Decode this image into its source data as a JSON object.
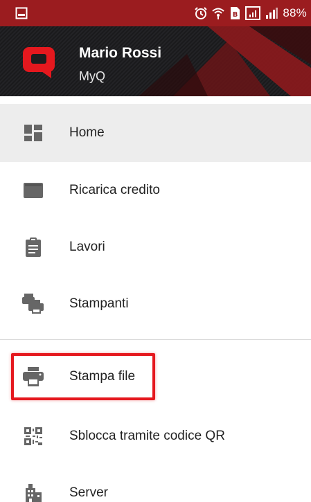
{
  "status_bar": {
    "battery": "88%",
    "background": "#9b1c1f",
    "icons": [
      "image-icon",
      "alarm-icon",
      "wifi-icon",
      "sim-icon",
      "signal-icon",
      "signal-icon"
    ]
  },
  "header": {
    "user_name": "Mario Rossi",
    "subtitle": "MyQ",
    "logo_color": "#e5181e"
  },
  "menu": {
    "items": [
      {
        "label": "Home",
        "icon": "dashboard-icon",
        "selected": true
      },
      {
        "label": "Ricarica credito",
        "icon": "credit-card-icon",
        "selected": false
      },
      {
        "label": "Lavori",
        "icon": "clipboard-icon",
        "selected": false
      },
      {
        "label": "Stampanti",
        "icon": "printers-icon",
        "selected": false
      },
      {
        "label": "Stampa file",
        "icon": "printer-icon",
        "selected": false
      },
      {
        "label": "Sblocca tramite codice QR",
        "icon": "qr-code-icon",
        "selected": false
      },
      {
        "label": "Server",
        "icon": "building-icon",
        "selected": false
      }
    ]
  },
  "highlight_color": "#e5181e"
}
